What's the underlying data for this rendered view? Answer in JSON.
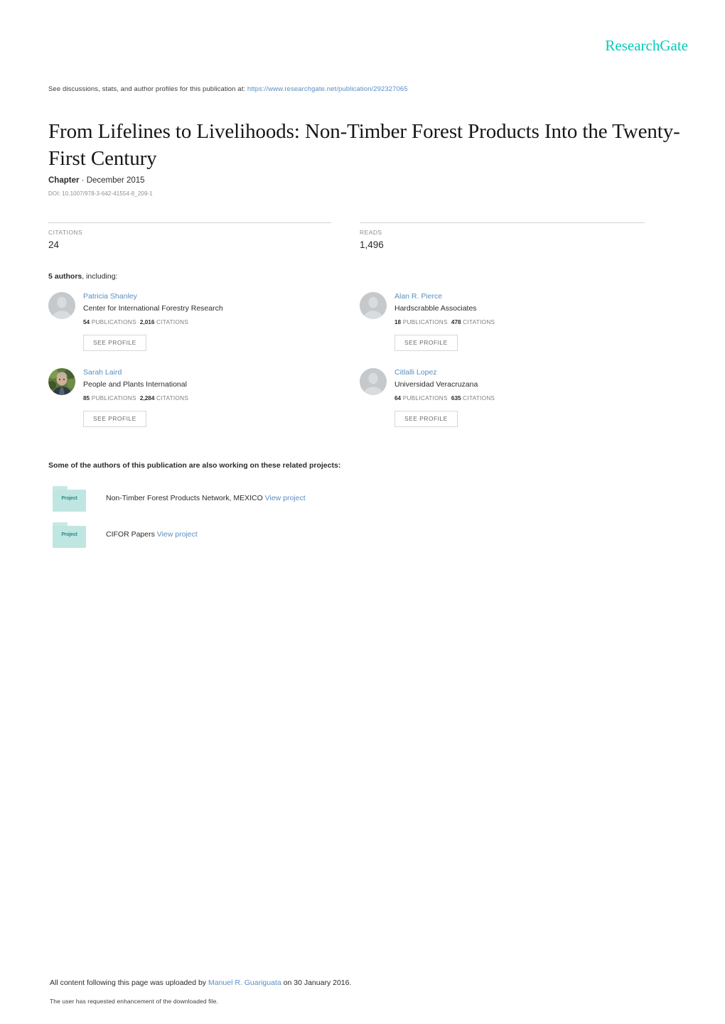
{
  "brand": {
    "logo_text": "ResearchGate",
    "logo_color": "#00ccbb",
    "link_color": "#5b8ec4"
  },
  "header": {
    "discussion_prefix": "See discussions, stats, and author profiles for this publication at:",
    "publication_url": "https://www.researchgate.net/publication/292327065"
  },
  "publication": {
    "title": "From Lifelines to Livelihoods: Non-Timber Forest Products Into the Twenty-First Century",
    "type_label": "Chapter",
    "date": "December 2015",
    "separator": "·",
    "doi": "DOI: 10.1007/978-3-642-41554-8_209-1"
  },
  "stats": [
    {
      "label": "CITATIONS",
      "value": "24"
    },
    {
      "label": "READS",
      "value": "1,496"
    }
  ],
  "authors_section": {
    "count_label": "5 authors",
    "count_suffix": ", including:",
    "see_profile_label": "SEE PROFILE",
    "publications_label": "PUBLICATIONS",
    "citations_label": "CITATIONS"
  },
  "authors": [
    {
      "name": "Patricia Shanley",
      "affiliation": "Center for International Forestry Research",
      "publications": "54",
      "citations": "2,016",
      "avatar": "default-avatar-icon"
    },
    {
      "name": "Alan R. Pierce",
      "affiliation": "Hardscrabble Associates",
      "publications": "18",
      "citations": "478",
      "avatar": "default-avatar-icon"
    },
    {
      "name": "Sarah Laird",
      "affiliation": "People and Plants International",
      "publications": "85",
      "citations": "2,284",
      "avatar": "photo-avatar"
    },
    {
      "name": "Citlalli Lopez",
      "affiliation": "Universidad Veracruzana",
      "publications": "64",
      "citations": "635",
      "avatar": "default-avatar-icon"
    }
  ],
  "projects_section": {
    "heading": "Some of the authors of this publication are also working on these related projects:",
    "folder_label": "Project",
    "view_project_label": "View project"
  },
  "projects": [
    {
      "title": "Non-Timber Forest Products Network, MEXICO"
    },
    {
      "title": "CIFOR Papers"
    }
  ],
  "footer": {
    "upload_prefix": "All content following this page was uploaded by",
    "uploader": "Manuel R. Guariguata",
    "upload_suffix": "on 30 January 2016.",
    "note": "The user has requested enhancement of the downloaded file."
  }
}
